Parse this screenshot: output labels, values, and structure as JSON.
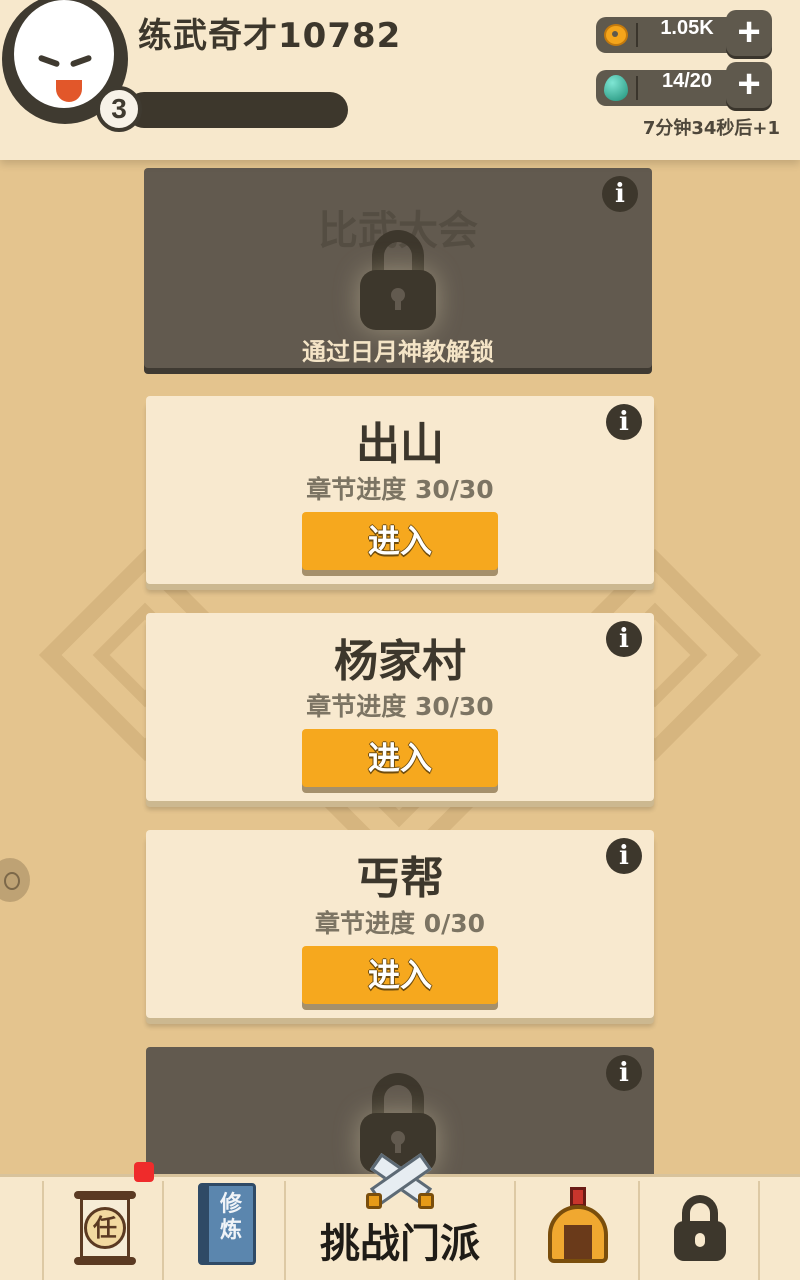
{
  "header": {
    "username": "练武奇才10782",
    "level": "3",
    "coins": "1.05K",
    "stamina": "14/20",
    "stamina_timer": "7分钟34秒后+1"
  },
  "cards": [
    {
      "title": "比武大会",
      "locked": true,
      "unlock_hint": "通过日月神教解锁"
    },
    {
      "title": "出山",
      "progress": "章节进度 30/30",
      "button": "进入"
    },
    {
      "title": "杨家村",
      "progress": "章节进度 30/30",
      "button": "进入"
    },
    {
      "title": "丐帮",
      "progress": "章节进度 0/30",
      "button": "进入"
    },
    {
      "locked": true
    }
  ],
  "bottom_nav": {
    "task_label": "任",
    "cultivate_label": "修炼",
    "challenge_label": "挑战门派"
  },
  "colors": {
    "background": "#e4c48e",
    "card": "#f8e9cf",
    "locked_card": "#625a4f",
    "button": "#f6a81e",
    "notification": "#ef2b2b"
  }
}
